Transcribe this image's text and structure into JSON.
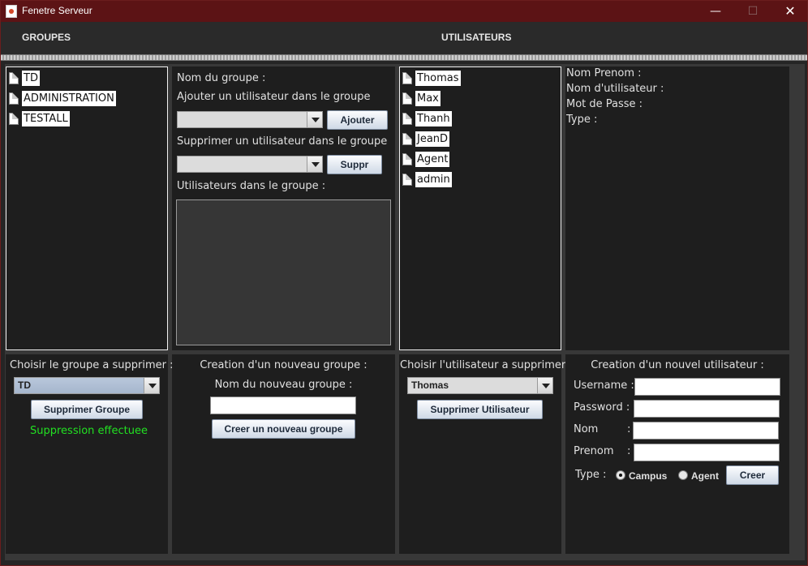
{
  "window": {
    "title": "Fenetre Serveur",
    "min": "—",
    "max": "☐",
    "close": "✕"
  },
  "header": {
    "groupes": "GROUPES",
    "utilisateurs": "UTILISATEURS"
  },
  "groups_list": [
    "TD",
    "ADMINISTRATION",
    "TESTALL"
  ],
  "group_detail": {
    "name_label": "Nom du groupe :",
    "add_label": "Ajouter un utilisateur dans le groupe",
    "add_button": "Ajouter",
    "remove_label": "Supprimer un utilisateur dans le groupe",
    "remove_button": "Suppr",
    "members_label": "Utilisateurs dans le groupe :"
  },
  "users_list": [
    "Thomas",
    "Max",
    "Thanh",
    "JeanD",
    "Agent",
    "admin"
  ],
  "user_detail": {
    "fullname_label": "Nom Prenom :",
    "username_label": "Nom d'utilisateur :",
    "password_label": "Mot de Passe :",
    "type_label": "Type :"
  },
  "delete_group": {
    "label": "Choisir le groupe a supprimer :",
    "selected": "TD",
    "button": "Supprimer Groupe",
    "status": "Suppression effectuee"
  },
  "create_group": {
    "title": "Creation d'un nouveau groupe :",
    "name_label": "Nom du nouveau groupe :",
    "name_value": "",
    "button": "Creer un nouveau groupe"
  },
  "delete_user": {
    "label": "Choisir l'utilisateur a supprimer :",
    "selected": "Thomas",
    "button": "Supprimer Utilisateur"
  },
  "create_user": {
    "title": "Creation d'un nouvel utilisateur :",
    "username_label": "Username :",
    "password_label": "Password :",
    "nom_label": "Nom",
    "prenom_label": "Prenom",
    "colon": ":",
    "type_label": "Type :",
    "campus": "Campus",
    "agent": "Agent",
    "selected_type": "Campus",
    "button": "Creer"
  },
  "colors": {
    "status_green": "#22e022",
    "titlebar": "#5c1315"
  }
}
